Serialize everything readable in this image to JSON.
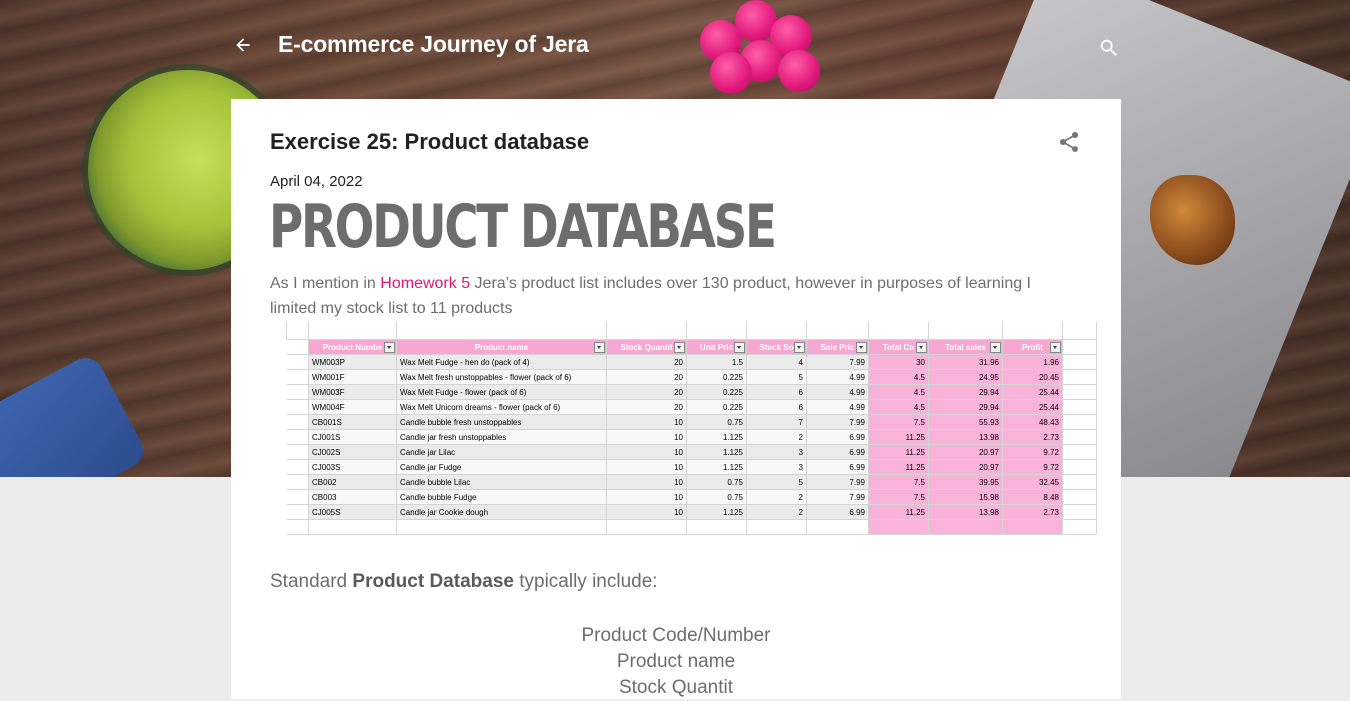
{
  "header": {
    "blog_title": "E-commerce Journey of Jera",
    "back_icon": "arrow-back-icon",
    "search_icon": "search-icon"
  },
  "post": {
    "title": "Exercise 25: Product database",
    "date": "April 04, 2022",
    "heading": "PRODUCT DATABASE",
    "intro_before": "As I mention in ",
    "intro_link": "Homework 5",
    "intro_after": " Jera’s product list includes over 130 product, however in purposes of learning I limited my stock list to 11 products",
    "standard_before": "Standard ",
    "standard_bold": "Product Database",
    "standard_after": " typically include:",
    "list_items": [
      "Product Code/Number",
      "Product name",
      "Stock Quantit"
    ]
  },
  "spreadsheet": {
    "headers": [
      "Product Numbe",
      "Product name",
      "Stock Quantit",
      "Unit Pric",
      "Stock So",
      "Sale Pric",
      "Total Co",
      "Total sales",
      "Profit"
    ],
    "rows": [
      [
        "WM003P",
        "Wax Melt Fudge - hen do (pack of 4)",
        "20",
        "1.5",
        "4",
        "7.99",
        "30",
        "31.96",
        "1.96"
      ],
      [
        "WM001F",
        "Wax Melt fresh unstoppables - flower (pack of 6)",
        "20",
        "0.225",
        "5",
        "4.99",
        "4.5",
        "24.95",
        "20.45"
      ],
      [
        "WM003F",
        "Wax Melt Fudge - flower (pack of 6)",
        "20",
        "0.225",
        "6",
        "4.99",
        "4.5",
        "29.94",
        "25.44"
      ],
      [
        "WM004F",
        "Wax Melt Unicorn dreams - flower (pack of 6)",
        "20",
        "0.225",
        "6",
        "4.99",
        "4.5",
        "29.94",
        "25.44"
      ],
      [
        "CB001S",
        "Candle bubble fresh unstoppables",
        "10",
        "0.75",
        "7",
        "7.99",
        "7.5",
        "55.93",
        "48.43"
      ],
      [
        "CJ001S",
        "Candle jar fresh unstoppables",
        "10",
        "1.125",
        "2",
        "6.99",
        "11.25",
        "13.98",
        "2.73"
      ],
      [
        "CJ002S",
        "Candle jar Lilac",
        "10",
        "1.125",
        "3",
        "6.99",
        "11.25",
        "20.97",
        "9.72"
      ],
      [
        "CJ003S",
        "Candle jar Fudge",
        "10",
        "1.125",
        "3",
        "6.99",
        "11.25",
        "20.97",
        "9.72"
      ],
      [
        "CB002",
        "Candle bubble Lilac",
        "10",
        "0.75",
        "5",
        "7.99",
        "7.5",
        "39.95",
        "32.45"
      ],
      [
        "CB003",
        "Candle bubble Fudge",
        "10",
        "0.75",
        "2",
        "7.99",
        "7.5",
        "15.98",
        "8.48"
      ],
      [
        "CJ005S",
        "Candle jar Cookie dough",
        "10",
        "1.125",
        "2",
        "6.99",
        "11.25",
        "13.98",
        "2.73"
      ]
    ]
  },
  "colors": {
    "accent": "#e0177a",
    "sheet_header": "#f7a8d2",
    "sheet_highlight": "#f9b3da"
  }
}
